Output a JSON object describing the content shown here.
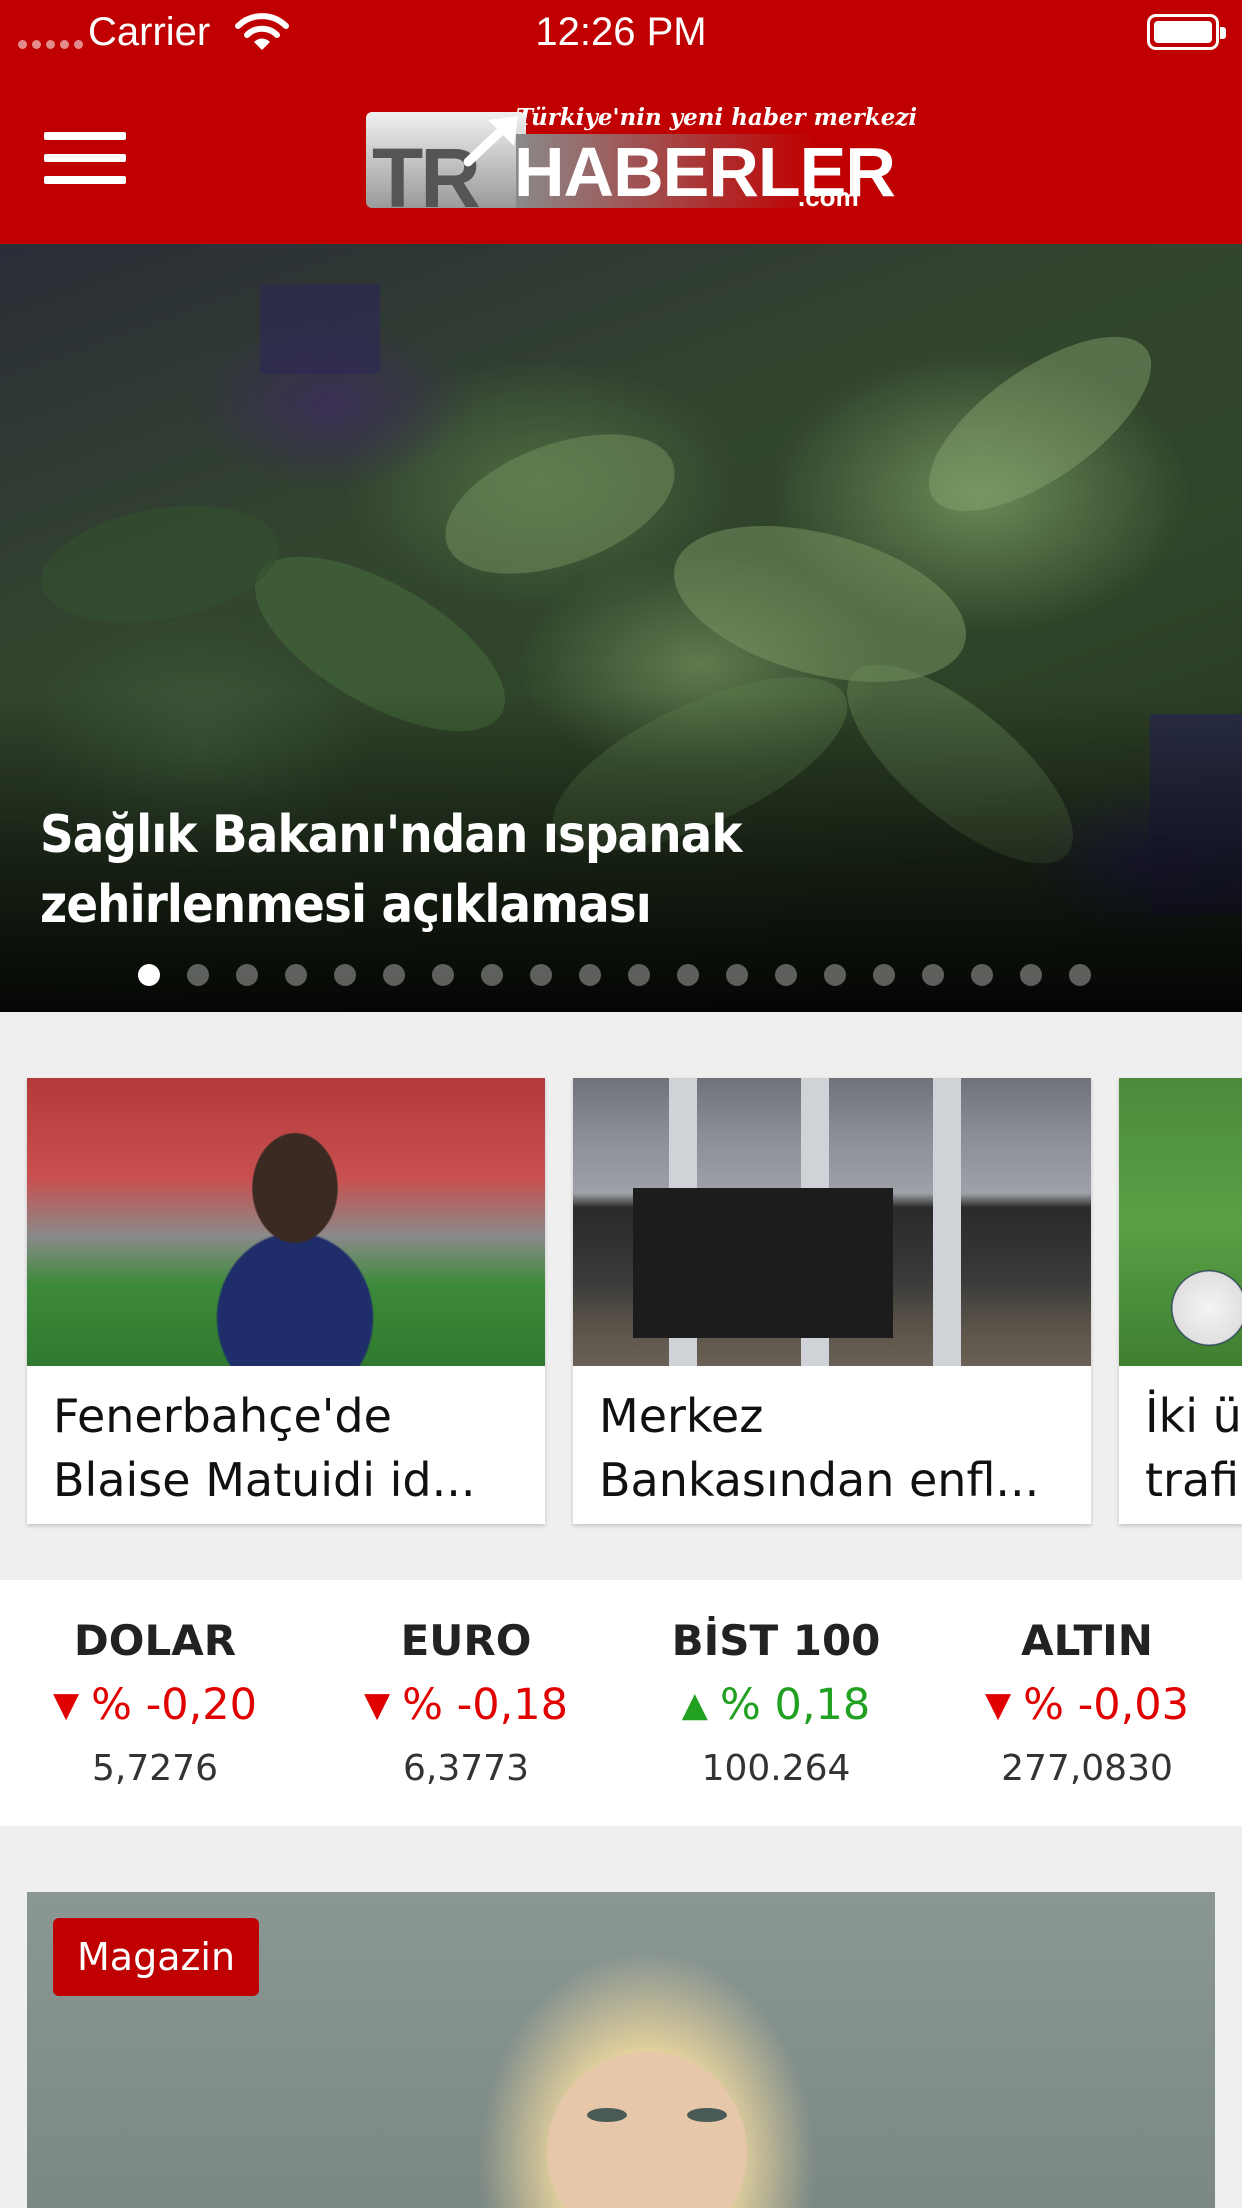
{
  "status_bar": {
    "carrier": "Carrier",
    "time": "12:26 PM"
  },
  "header": {
    "logo_tagline": "Türkiye'nin yeni haber merkezi",
    "logo_tr": "TR",
    "logo_main": "HABERLER",
    "logo_suffix": ".com",
    "brand_color": "#c00000"
  },
  "hero": {
    "title": "Sağlık Bakanı'ndan ıspanak zehirlenmesi açıklaması",
    "dot_count": 20,
    "active_dot": 1
  },
  "cards": [
    {
      "line1": "Fenerbahçe'de",
      "line2": "Blaise Matuidi id..."
    },
    {
      "line1": "Merkez",
      "line2": "Bankasından enfl..."
    },
    {
      "line1": "İki ü",
      "line2": "trafi"
    }
  ],
  "market": [
    {
      "name": "DOLAR",
      "direction": "down",
      "arrow": "▼",
      "change": "% -0,20",
      "value": "5,7276"
    },
    {
      "name": "EURO",
      "direction": "down",
      "arrow": "▼",
      "change": "% -0,18",
      "value": "6,3773"
    },
    {
      "name": "BİST 100",
      "direction": "up",
      "arrow": "▲",
      "change": "% 0,18",
      "value": "100.264"
    },
    {
      "name": "ALTIN",
      "direction": "down",
      "arrow": "▼",
      "change": "% -0,03",
      "value": "277,0830"
    }
  ],
  "colors": {
    "down": "#e00000",
    "up": "#22a022"
  },
  "feature": {
    "category": "Magazin"
  }
}
